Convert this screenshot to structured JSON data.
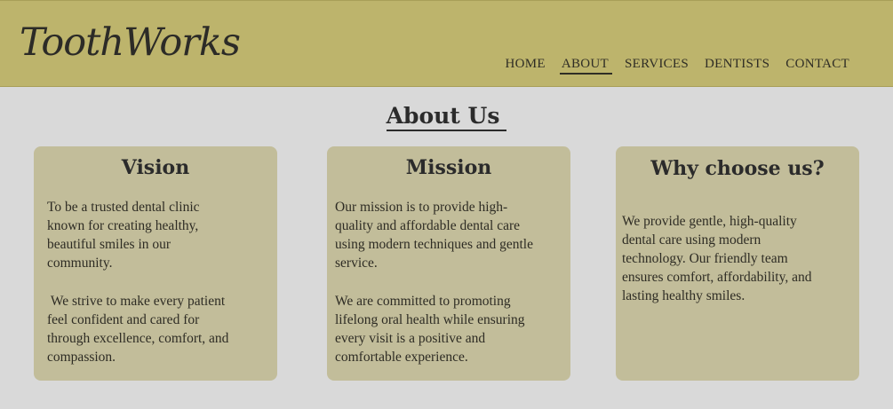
{
  "brand": {
    "logo_text": "ToothWorks"
  },
  "nav": {
    "items": [
      {
        "label": "HOME"
      },
      {
        "label": "ABOUT"
      },
      {
        "label": "SERVICES"
      },
      {
        "label": "DENTISTS"
      },
      {
        "label": "CONTACT"
      }
    ],
    "active": "ABOUT"
  },
  "page": {
    "title": "About Us"
  },
  "cards": [
    {
      "title": "Vision",
      "paragraphs": [
        "To be a trusted dental clinic\nknown for creating healthy,\nbeautiful smiles in our\ncommunity.",
        " We strive to make every patient\nfeel confident and cared for\nthrough excellence, comfort, and\ncompassion."
      ]
    },
    {
      "title": "Mission",
      "paragraphs": [
        "Our mission is to provide high-\nquality and affordable dental care\nusing modern techniques and gentle\nservice.",
        "We are committed to promoting\nlifelong oral health while ensuring\nevery visit is a positive and\ncomfortable experience."
      ]
    },
    {
      "title": "Why choose us?",
      "paragraphs": [
        "We provide gentle, high-quality\ndental care using modern\ntechnology. Our friendly team\nensures comfort, affordability, and\nlasting healthy smiles."
      ]
    }
  ],
  "colors": {
    "header_bg": "#bdb46c",
    "page_bg": "#d9d9d9",
    "card_bg": "#c2bd9a",
    "text": "#2b2b2b"
  }
}
